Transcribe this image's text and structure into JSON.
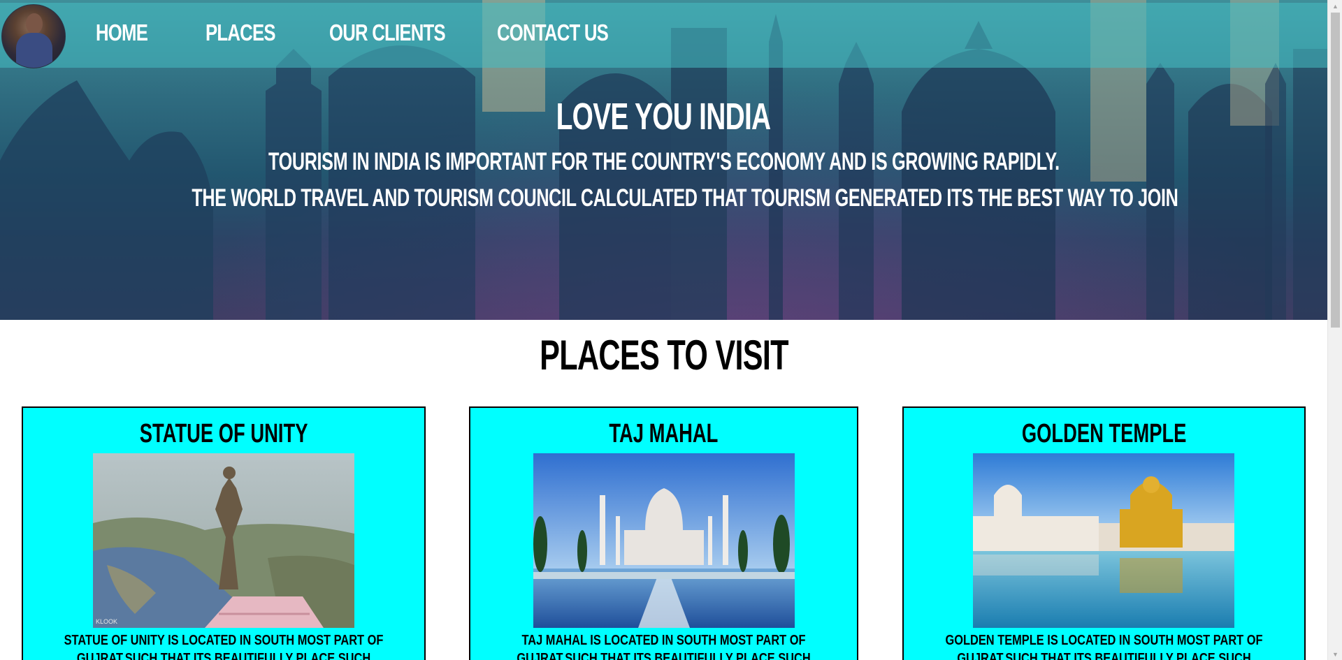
{
  "nav": {
    "avatar_alt": "profile photo",
    "links": [
      "HOME",
      "PLACES",
      "OUR CLIENTS",
      "CONTACT US"
    ]
  },
  "hero": {
    "title": "LOVE YOU INDIA",
    "line1": "TOURISM IN INDIA IS IMPORTANT FOR THE COUNTRY'S ECONOMY AND IS GROWING RAPIDLY.",
    "line2": "THE WORLD TRAVEL AND TOURISM COUNCIL CALCULATED THAT TOURISM GENERATED ITS THE BEST WAY TO JOIN"
  },
  "places": {
    "section_title": "PLACES TO VISIT",
    "cards": [
      {
        "title": "STATUE OF UNITY",
        "photo_watermark": "KLOOK",
        "description": "STATUE OF UNITY IS LOCATED IN SOUTH MOST PART OF GUJRAT.SUCH THAT ITS BEAUTIFULLY PLACE SUCH THAT BEST SPOT FOR TOURISM AND BEST WAY TO"
      },
      {
        "title": "TAJ MAHAL",
        "description": "TAJ MAHAL IS LOCATED IN SOUTH MOST PART OF GUJRAT.SUCH THAT ITS BEAUTIFULLY PLACE SUCH THAT BEST SPOT FOR TOURISM AND BEST WAY"
      },
      {
        "title": "GOLDEN TEMPLE",
        "description": "GOLDEN TEMPLE IS LOCATED IN SOUTH MOST PART OF GUJRAT.SUCH THAT ITS BEAUTIFULLY PLACE SUCH THAT BEST SPOT FOR TOURISM AND BEST WAY TO"
      }
    ]
  },
  "colors": {
    "card_background": "#00ffff",
    "navbar_overlay": "#46bec3",
    "hero_top": "#3f8e99",
    "hero_bottom": "#3e3d63"
  }
}
